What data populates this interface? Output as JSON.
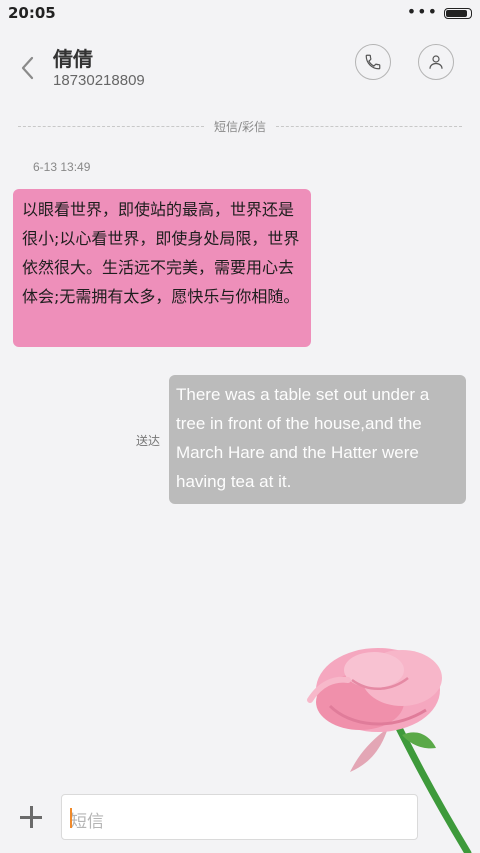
{
  "status_bar": {
    "time": "20:05",
    "signal_dots": "•••",
    "battery_level": 0.9
  },
  "header": {
    "contact_name": "倩倩",
    "contact_number": "18730218809",
    "icons": [
      "back-icon",
      "phone-icon",
      "person-icon"
    ]
  },
  "conversation": {
    "divider_label": "短信/彩信",
    "timestamp": "6-13 13:49",
    "messages": [
      {
        "direction": "incoming",
        "text": "以眼看世界，即使站的最高，世界还是很小;以心看世界，即使身处局限，世界依然很大。生活远不完美，需要用心去体会;无需拥有太多，愿快乐与你相随。"
      },
      {
        "direction": "outgoing",
        "text": "There was a table set out under a tree in front of the house,and the March Hare and the Hatter were having tea at it.",
        "status": "送达"
      }
    ]
  },
  "composer": {
    "placeholder": "短信",
    "add_icon": "plus-icon"
  },
  "colors": {
    "background": "#f3f3f5",
    "incoming_bubble": "#ee8fba",
    "outgoing_bubble": "#bbbbbb",
    "cursor": "#f08a2b"
  }
}
